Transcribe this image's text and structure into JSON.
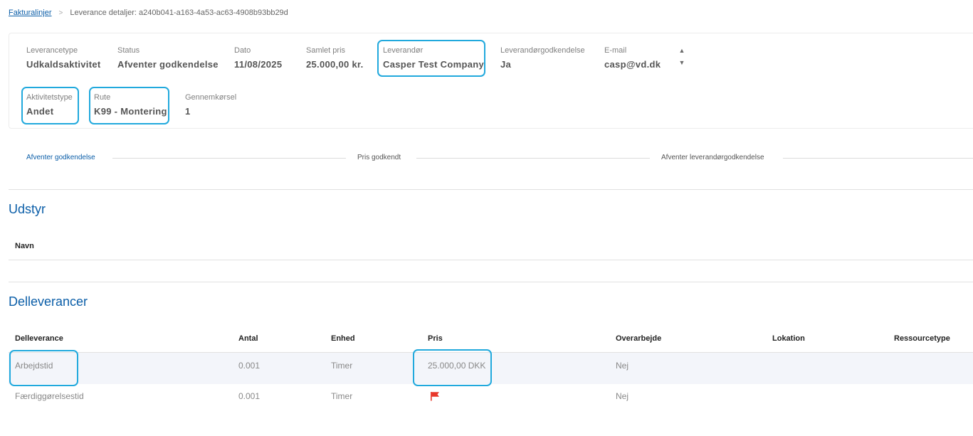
{
  "breadcrumb": {
    "link": "Fakturalinjer",
    "current": "Leverance detaljer: a240b041-a163-4a53-ac63-4908b93bb29d"
  },
  "summary": {
    "leverancetype": {
      "label": "Leverancetype",
      "value": "Udkaldsaktivitet"
    },
    "status": {
      "label": "Status",
      "value": "Afventer godkendelse"
    },
    "dato": {
      "label": "Dato",
      "value": "11/08/2025"
    },
    "samlet_pris": {
      "label": "Samlet pris",
      "value": "25.000,00 kr."
    },
    "leverandor": {
      "label": "Leverandør",
      "value": "Casper Test Company"
    },
    "leverandorgodkendelse": {
      "label": "Leverandørgodkendelse",
      "value": "Ja"
    },
    "email": {
      "label": "E-mail",
      "value": "casp@vd.dk"
    },
    "aktivitetstype": {
      "label": "Aktivitetstype",
      "value": "Andet"
    },
    "rute": {
      "label": "Rute",
      "value": "K99 - Montering"
    },
    "gennemkorsel": {
      "label": "Gennemkørsel",
      "value": "1"
    }
  },
  "icons": {
    "sort_up": "▲",
    "sort_down": "▼",
    "flag": "red-flag-icon"
  },
  "steps": [
    "Afventer godkendelse",
    "Pris godkendt",
    "Afventer leverandørgodkendelse"
  ],
  "udstyr": {
    "title": "Udstyr",
    "columns": [
      "Navn"
    ]
  },
  "delleverancer": {
    "title": "Delleverancer",
    "columns": [
      "Delleverance",
      "Antal",
      "Enhed",
      "Pris",
      "Overarbejde",
      "Lokation",
      "Ressourcetype"
    ],
    "rows": [
      {
        "delleverance": "Arbejdstid",
        "antal": "0.001",
        "enhed": "Timer",
        "pris": "25.000,00 DKK",
        "overarbejde": "Nej",
        "lokation": "",
        "ressourcetype": ""
      },
      {
        "delleverance": "Færdiggørelsestid",
        "antal": "0.001",
        "enhed": "Timer",
        "pris": "",
        "overarbejde": "Nej",
        "lokation": "",
        "ressourcetype": ""
      }
    ]
  },
  "colors": {
    "accent": "#0b5ea8",
    "highlight": "#21a9dd",
    "flag": "#e8372a",
    "row_alt": "#f3f5fa"
  }
}
